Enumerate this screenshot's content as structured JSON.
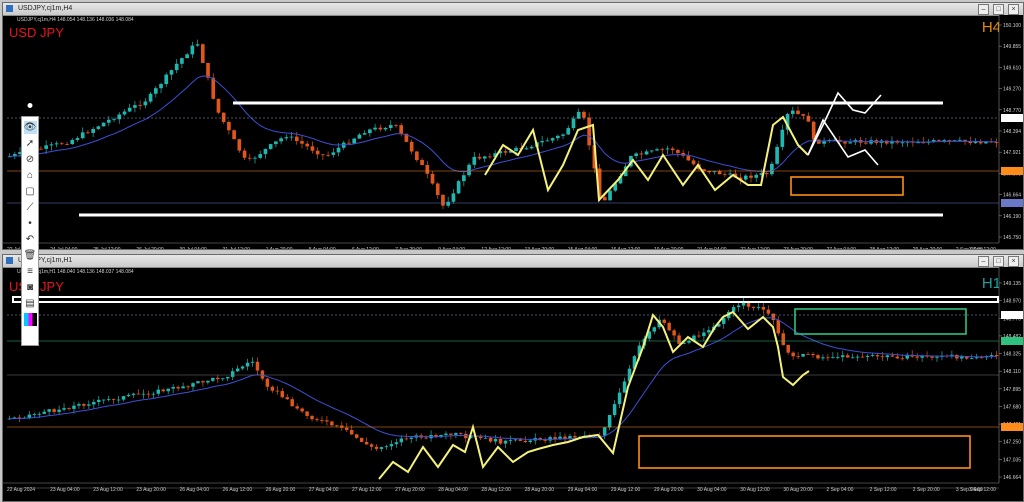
{
  "colors": {
    "bg": "#000000",
    "bull": "#1fb8b0",
    "bear": "#e0561c",
    "ma": "#3d4fd6",
    "trend": "#f5f27a",
    "orange": "#ff8c1a",
    "green": "#2ec27e",
    "white": "#ffffff",
    "sym": "#e8141e",
    "h4": "#e58b00",
    "h1": "#1ea0a0"
  },
  "top": {
    "title": "USDJPY,cj1m,H4",
    "info": "USDJPY,cj1m,H4  148.054 148.136 148.036 148.084",
    "symbol": "USD JPY",
    "timeframe": "H4",
    "y_ticks": [
      "150.100",
      "149.855",
      "149.610",
      "149.270",
      "148.770",
      "148.394",
      "147.921",
      "147.070",
      "146.664",
      "146.190",
      "145.750"
    ],
    "x_ticks": [
      "22 Jul 2024",
      "24 Jul 04:00",
      "25 Jul 12:00",
      "26 Jul 20:00",
      "30 Jul 04:00",
      "31 Jul 12:00",
      "1 Aug 20:00",
      "5 Aug 04:00",
      "6 Aug 12:00",
      "7 Aug 20:00",
      "9 Aug 04:00",
      "12 Aug 12:00",
      "13 Aug 20:00",
      "15 Aug 04:00",
      "16 Aug 12:00",
      "19 Aug 20:00",
      "21 Aug 04:00",
      "22 Aug 12:00",
      "23 Aug 20:00",
      "27 Aug 04:00",
      "28 Aug 12:00",
      "29 Aug 20:00",
      "2 Sep 04:00",
      "3 Sep 12:00"
    ]
  },
  "bottom": {
    "title": "USDJPY,cj1m,H1",
    "info": "USDJPY,cj1m,H1  148.040 148.136 148.037 148.084",
    "symbol": "USD JPY",
    "timeframe": "H1",
    "y_ticks": [
      "149.135",
      "148.970",
      "148.770",
      "148.482",
      "148.325",
      "148.110",
      "147.895",
      "147.680",
      "147.421",
      "147.250",
      "147.035",
      "146.664"
    ],
    "x_ticks": [
      "22 Aug 2024",
      "23 Aug 04:00",
      "23 Aug 12:00",
      "23 Aug 20:00",
      "26 Aug 04:00",
      "26 Aug 12:00",
      "26 Aug 20:00",
      "27 Aug 04:00",
      "27 Aug 12:00",
      "27 Aug 20:00",
      "28 Aug 04:00",
      "28 Aug 12:00",
      "28 Aug 20:00",
      "29 Aug 04:00",
      "29 Aug 12:00",
      "29 Aug 20:00",
      "30 Aug 04:00",
      "30 Aug 12:00",
      "30 Aug 20:00",
      "2 Sep 04:00",
      "2 Sep 12:00",
      "2 Sep 20:00",
      "3 Sep 04:00",
      "3 Sep 12:00"
    ]
  },
  "toolbar": {
    "items": [
      "eye-icon",
      "cursor-icon",
      "magnet-icon",
      "tag-icon",
      "square-icon",
      "ruler-icon",
      "dot-icon",
      "undo-icon",
      "trash-icon",
      "layers-icon",
      "camera-icon",
      "clipboard-icon",
      "palette-icon"
    ]
  }
}
